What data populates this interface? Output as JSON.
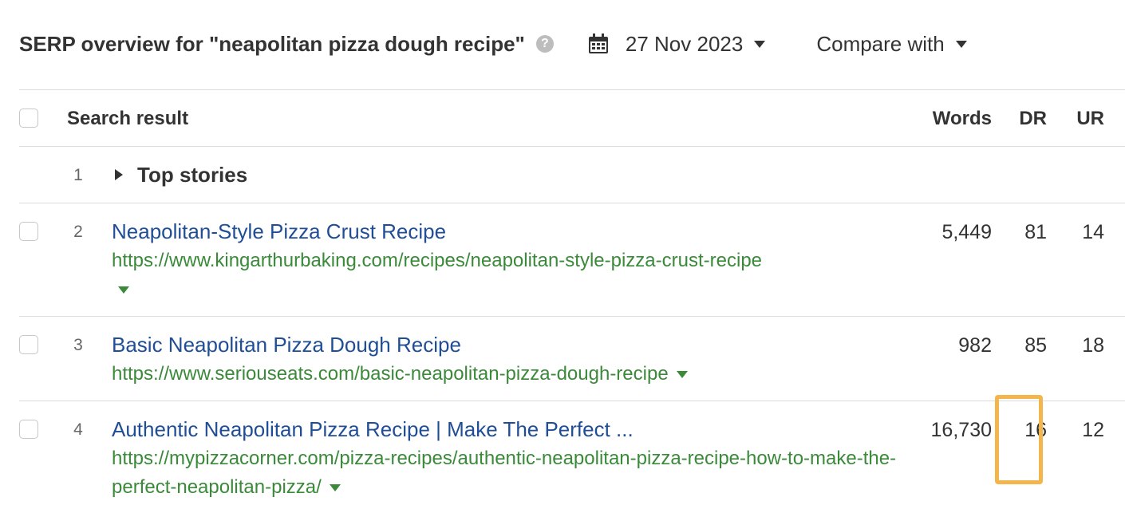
{
  "header": {
    "title": "SERP overview for \"neapolitan pizza dough recipe\"",
    "help_glyph": "?",
    "date_label": "27 Nov 2023",
    "compare_label": "Compare with"
  },
  "table": {
    "columns": {
      "search_result": "Search result",
      "words": "Words",
      "dr": "DR",
      "ur": "UR"
    },
    "top_stories": {
      "position": "1",
      "label": "Top stories"
    },
    "results": [
      {
        "position": "2",
        "title": "Neapolitan-Style Pizza Crust Recipe",
        "url": "https://www.kingarthurbaking.com/recipes/neapolitan-style-pizza-crust-recipe",
        "words": "5,449",
        "dr": "81",
        "ur": "14"
      },
      {
        "position": "3",
        "title": "Basic Neapolitan Pizza Dough Recipe",
        "url": "https://www.seriouseats.com/basic-neapolitan-pizza-dough-recipe",
        "words": "982",
        "dr": "85",
        "ur": "18"
      },
      {
        "position": "4",
        "title": "Authentic Neapolitan Pizza Recipe | Make The Perfect ...",
        "url": "https://mypizzacorner.com/pizza-recipes/authentic-neapolitan-pizza-recipe-how-to-make-the-perfect-neapolitan-pizza/",
        "words": "16,730",
        "dr": "16",
        "ur": "12"
      }
    ]
  },
  "colors": {
    "link_title": "#1f4e96",
    "link_url": "#3a8a3a",
    "highlight": "#f2b64c"
  },
  "icons": {
    "help": "help-icon",
    "calendar": "calendar-icon",
    "dropdown": "chevron-down-icon",
    "expand": "chevron-right-icon"
  }
}
